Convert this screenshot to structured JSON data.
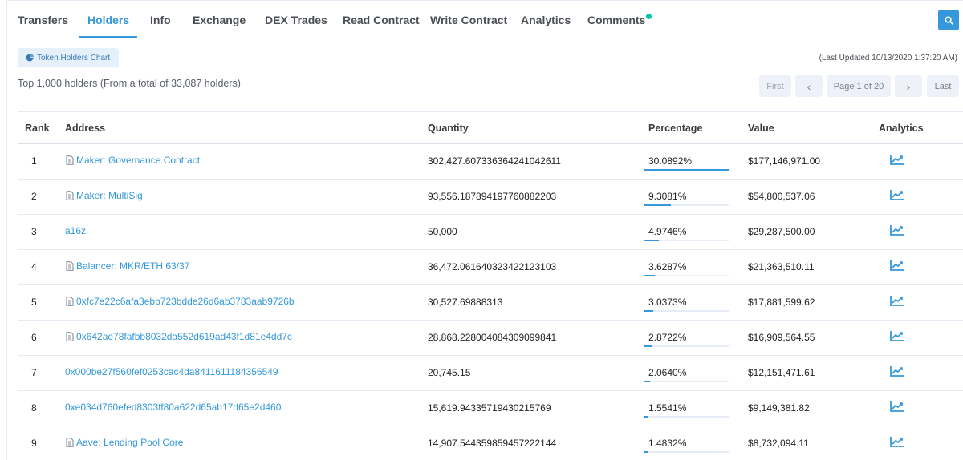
{
  "tabs": [
    {
      "label": "Transfers",
      "active": false
    },
    {
      "label": "Holders",
      "active": true
    },
    {
      "label": "Info",
      "active": false
    },
    {
      "label": "Exchange",
      "active": false
    },
    {
      "label": "DEX Trades",
      "active": false
    },
    {
      "label": "Read Contract",
      "active": false
    },
    {
      "label": "Write Contract",
      "active": false
    },
    {
      "label": "Analytics",
      "active": false
    },
    {
      "label": "Comments",
      "active": false
    }
  ],
  "toolbar": {
    "chart_button": "Token Holders Chart",
    "last_updated": "(Last Updated 10/13/2020 1:37:20 AM)",
    "summary": "Top 1,000 holders (From a total of 33,087 holders)"
  },
  "pagination": {
    "first": "First",
    "prev": "‹",
    "page_info": "Page 1 of 20",
    "next": "›",
    "last": "Last"
  },
  "table": {
    "headers": [
      "Rank",
      "Address",
      "Quantity",
      "Percentage",
      "Value",
      "Analytics"
    ],
    "rows": [
      {
        "rank": "1",
        "address": "Maker: Governance Contract",
        "is_contract": true,
        "quantity": "302,427.607336364241042611",
        "percentage": "30.0892%",
        "pct_value": 30.0892,
        "value": "$177,146,971.00"
      },
      {
        "rank": "2",
        "address": "Maker: MultiSig",
        "is_contract": true,
        "quantity": "93,556.187894197760882203",
        "percentage": "9.3081%",
        "pct_value": 9.3081,
        "value": "$54,800,537.06"
      },
      {
        "rank": "3",
        "address": "a16z",
        "is_contract": false,
        "quantity": "50,000",
        "percentage": "4.9746%",
        "pct_value": 4.9746,
        "value": "$29,287,500.00"
      },
      {
        "rank": "4",
        "address": "Balancer: MKR/ETH 63/37",
        "is_contract": true,
        "quantity": "36,472.061640323422123103",
        "percentage": "3.6287%",
        "pct_value": 3.6287,
        "value": "$21,363,510.11"
      },
      {
        "rank": "5",
        "address": "0xfc7e22c6afa3ebb723bdde26d6ab3783aab9726b",
        "is_contract": true,
        "quantity": "30,527.69888313",
        "percentage": "3.0373%",
        "pct_value": 3.0373,
        "value": "$17,881,599.62"
      },
      {
        "rank": "6",
        "address": "0x642ae78fafbb8032da552d619ad43f1d81e4dd7c",
        "is_contract": true,
        "quantity": "28,868.228004084309099841",
        "percentage": "2.8722%",
        "pct_value": 2.8722,
        "value": "$16,909,564.55"
      },
      {
        "rank": "7",
        "address": "0x000be27f560fef0253cac4da8411611184356549",
        "is_contract": false,
        "quantity": "20,745.15",
        "percentage": "2.0640%",
        "pct_value": 2.064,
        "value": "$12,151,471.61"
      },
      {
        "rank": "8",
        "address": "0xe034d760efed8303ff80a622d65ab17d65e2d460",
        "is_contract": false,
        "quantity": "15,619.94335719430215769",
        "percentage": "1.5541%",
        "pct_value": 1.5541,
        "value": "$9,149,381.82"
      },
      {
        "rank": "9",
        "address": "Aave: Lending Pool Core",
        "is_contract": true,
        "quantity": "14,907.544359859457222144",
        "percentage": "1.4832%",
        "pct_value": 1.4832,
        "value": "$8,732,094.11"
      }
    ]
  },
  "colors": {
    "accent": "#3498db",
    "new_dot": "#00c9a7"
  },
  "icons": {
    "search": "search-icon",
    "chart": "pie-chart-icon",
    "contract": "document-icon",
    "analytics": "line-chart-icon"
  }
}
